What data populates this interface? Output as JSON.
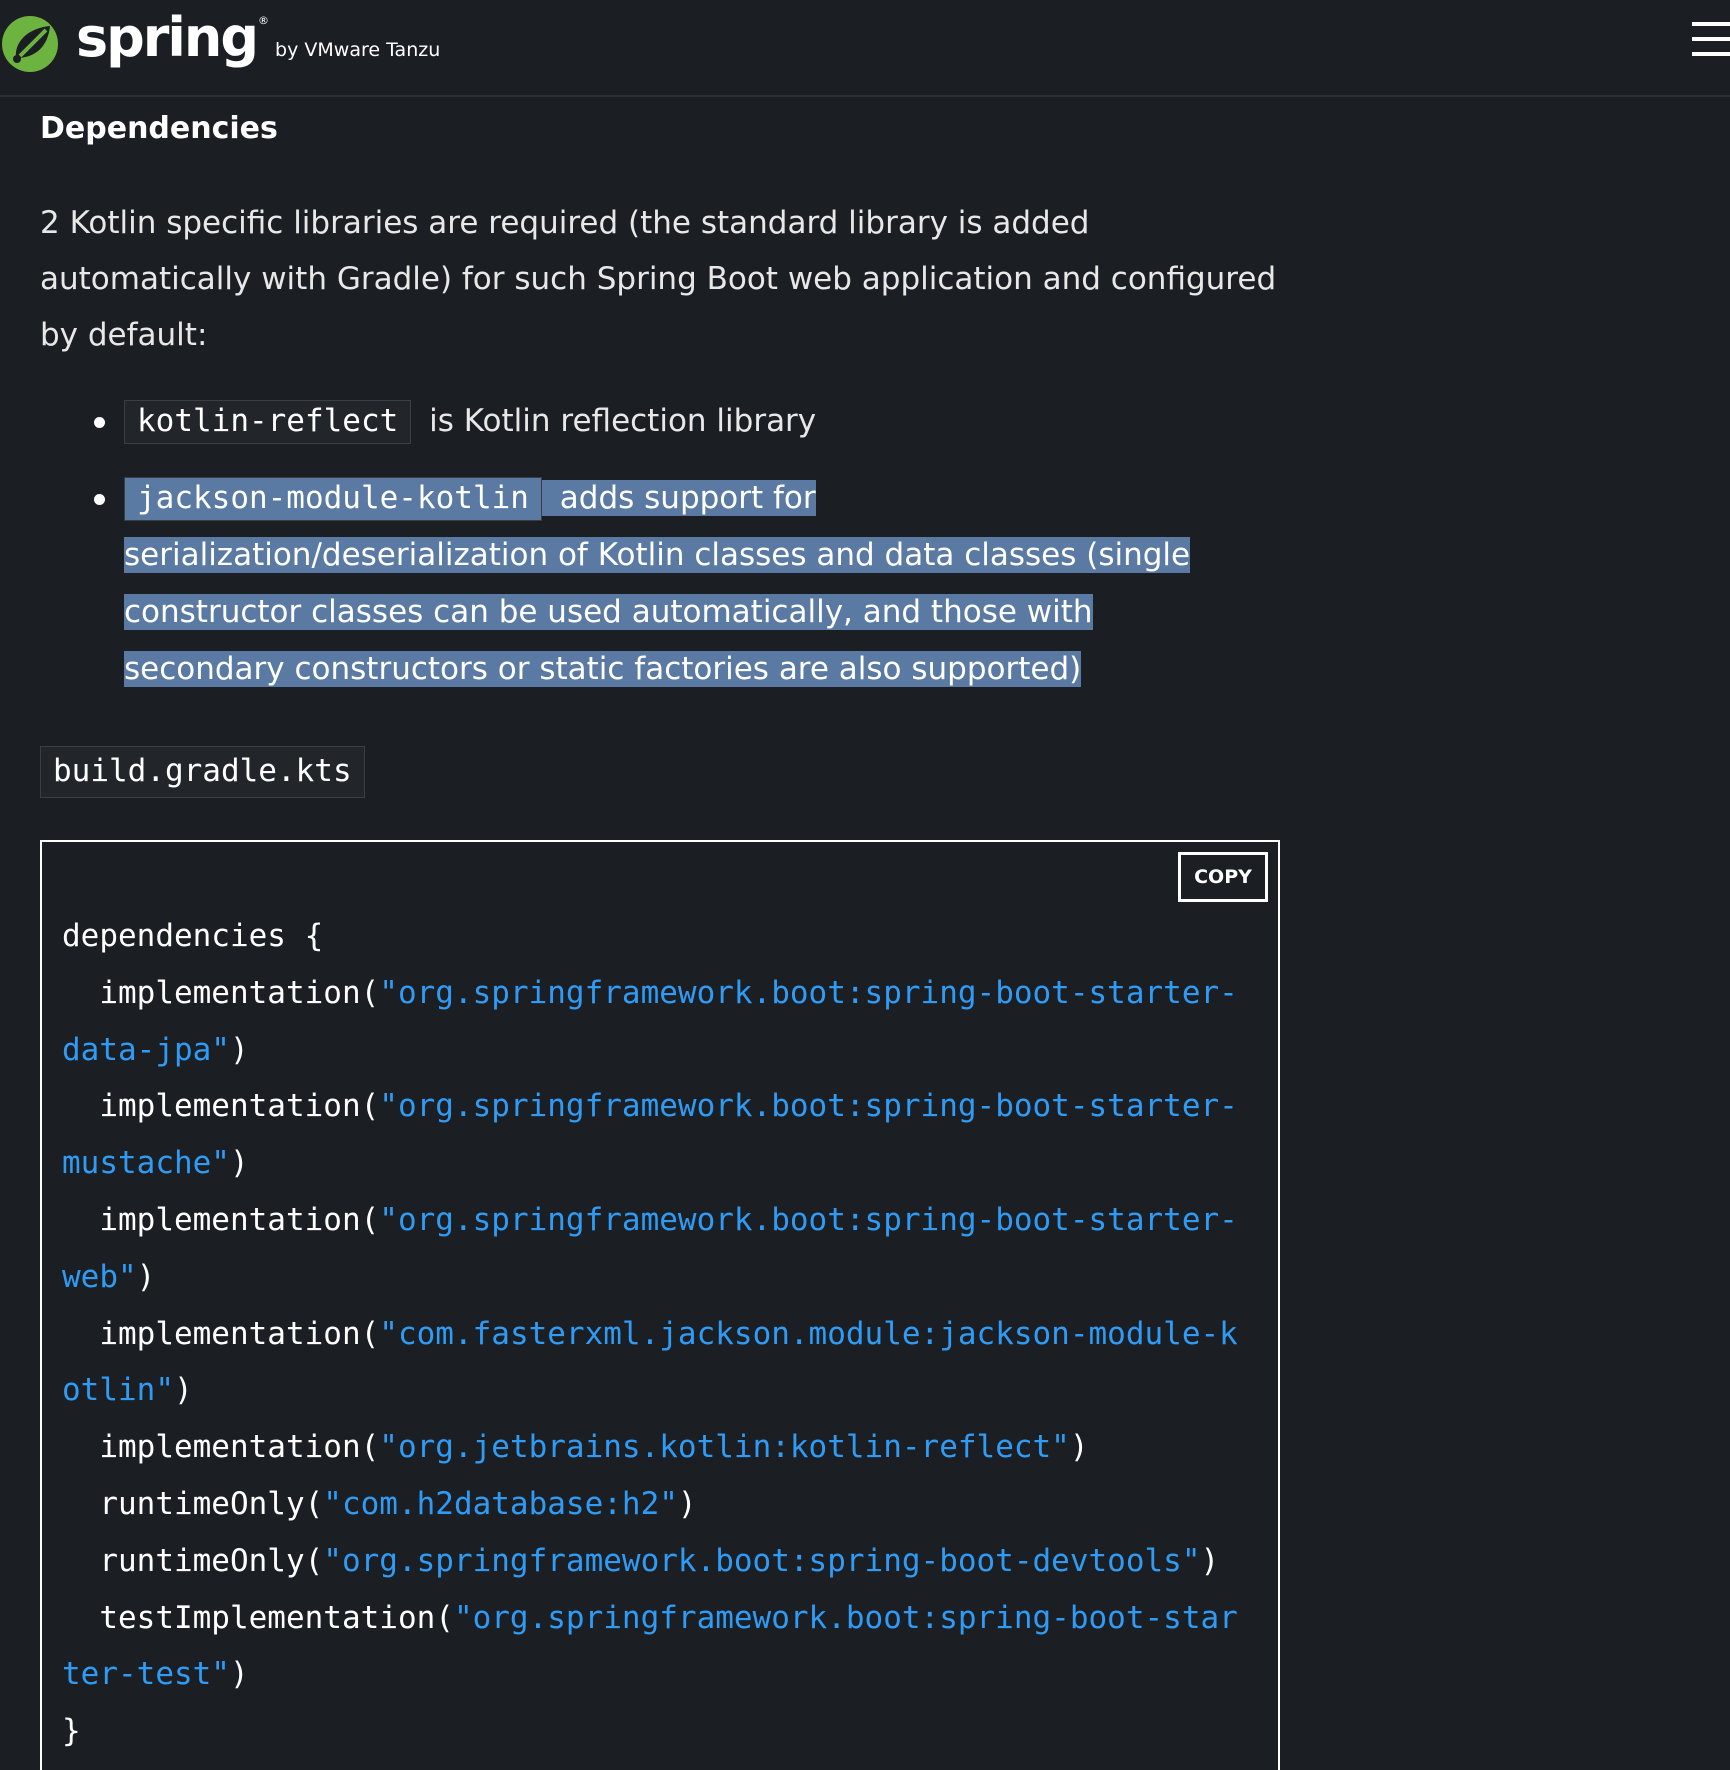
{
  "header": {
    "logo_word": "spring",
    "logo_reg": "®",
    "logo_by": "by VMware Tanzu",
    "menu_icon": "hamburger-menu-icon"
  },
  "section": {
    "title": "Dependencies",
    "intro": "2 Kotlin specific libraries are required (the standard library is added automatically with Gradle) for such Spring Boot web application and configured by default:"
  },
  "libs": [
    {
      "code": "kotlin-reflect",
      "text": " is Kotlin reflection library"
    },
    {
      "code": "jackson-module-kotlin",
      "text": " adds support for serialization/deserialization of Kotlin classes and data classes (single constructor classes can be used automatically, and those with secondary constructors or static factories are also supported)"
    }
  ],
  "file": {
    "name": "build.gradle.kts"
  },
  "codeblock": {
    "copy_label": "COPY",
    "open": "dependencies {",
    "close": "}",
    "lines": [
      {
        "fn": "  implementation(",
        "arg": "\"org.springframework.boot:spring-boot-starter-data-jpa\"",
        "end": ")"
      },
      {
        "fn": "  implementation(",
        "arg": "\"org.springframework.boot:spring-boot-starter-mustache\"",
        "end": ")"
      },
      {
        "fn": "  implementation(",
        "arg": "\"org.springframework.boot:spring-boot-starter-web\"",
        "end": ")"
      },
      {
        "fn": "  implementation(",
        "arg": "\"com.fasterxml.jackson.module:jackson-module-kotlin\"",
        "end": ")"
      },
      {
        "fn": "  implementation(",
        "arg": "\"org.jetbrains.kotlin:kotlin-reflect\"",
        "end": ")"
      },
      {
        "fn": "  runtimeOnly(",
        "arg": "\"com.h2database:h2\"",
        "end": ")"
      },
      {
        "fn": "  runtimeOnly(",
        "arg": "\"org.springframework.boot:spring-boot-devtools\"",
        "end": ")"
      },
      {
        "fn": "  testImplementation(",
        "arg": "\"org.springframework.boot:spring-boot-starter-test\"",
        "end": ")"
      }
    ]
  },
  "colors": {
    "background": "#1b1f23",
    "string": "#2f9bf5",
    "selection": "#5a7aa3",
    "brand_green": "#6db33f"
  }
}
